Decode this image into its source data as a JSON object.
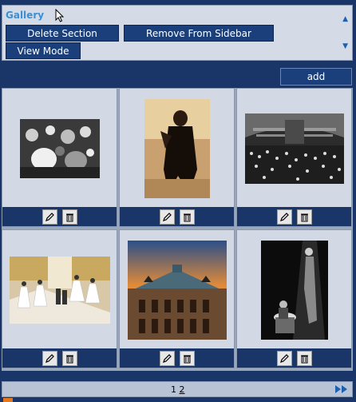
{
  "section": {
    "title": "Gallery",
    "buttons": {
      "delete_section": "Delete Section",
      "remove_from_sidebar": "Remove From Sidebar",
      "view_mode": "View Mode"
    },
    "icons": [
      "arrow-up-icon",
      "arrow-down-icon"
    ]
  },
  "add_label": "add",
  "gallery": {
    "items": [
      {
        "name": "crowd-dancing-bw",
        "icons": [
          "edit-icon",
          "delete-icon"
        ]
      },
      {
        "name": "dancer-in-tails",
        "icons": [
          "edit-icon",
          "delete-icon"
        ]
      },
      {
        "name": "opera-hall-bw",
        "icons": [
          "edit-icon",
          "delete-icon"
        ]
      },
      {
        "name": "debutantes-staircase",
        "icons": [
          "edit-icon",
          "delete-icon"
        ]
      },
      {
        "name": "opera-house-exterior",
        "icons": [
          "edit-icon",
          "delete-icon"
        ]
      },
      {
        "name": "spotlight-bw",
        "icons": [
          "edit-icon",
          "delete-icon"
        ]
      }
    ]
  },
  "pager": {
    "current_page": "1",
    "next_page": "2"
  },
  "colors": {
    "background": "#1a3668",
    "accent_title": "#3d8fd1",
    "button": "#1a3f7a",
    "panel": "#d4dbe6"
  }
}
